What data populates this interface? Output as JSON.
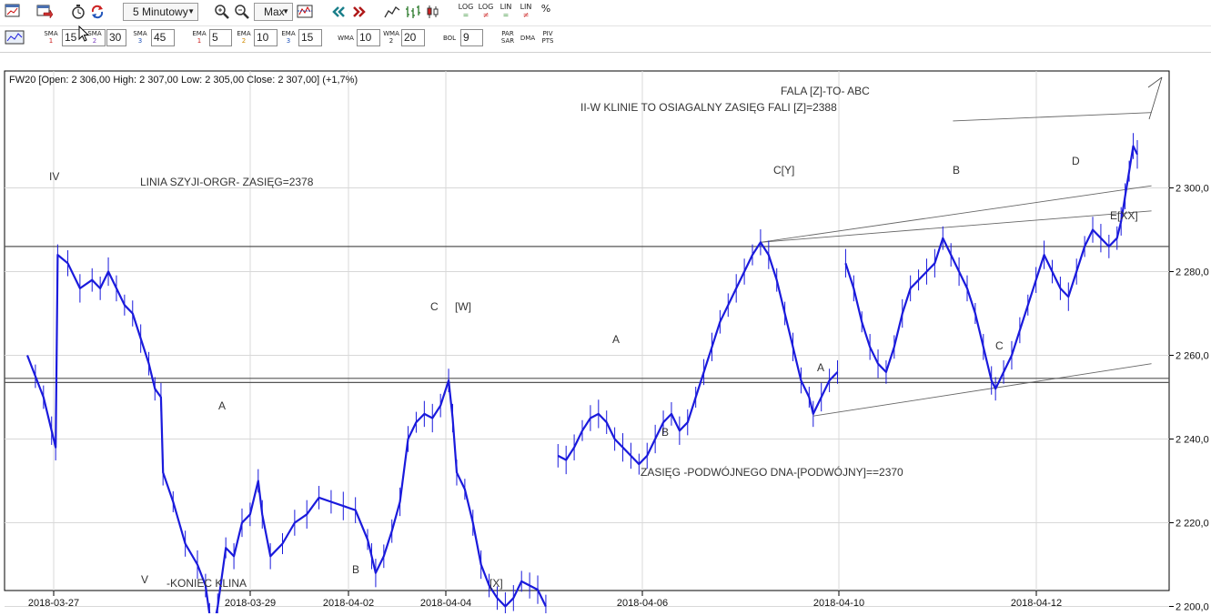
{
  "toolbar1": {
    "interval": "5 Minutowy",
    "range": "Max",
    "scale_buttons": [
      {
        "top": "LOG",
        "sub": "="
      },
      {
        "top": "LOG",
        "sub": "≠"
      },
      {
        "top": "LIN",
        "sub": "="
      },
      {
        "top": "LIN",
        "sub": "≠"
      },
      {
        "top": "%",
        "sub": ""
      }
    ]
  },
  "toolbar2": {
    "sma": [
      {
        "label": "SMA",
        "num": "1",
        "value": "15"
      },
      {
        "label": "SMA",
        "num": "2",
        "value": "30"
      },
      {
        "label": "SMA",
        "num": "3",
        "value": "45"
      }
    ],
    "ema": [
      {
        "label": "EMA",
        "num": "1",
        "value": "5"
      },
      {
        "label": "EMA",
        "num": "2",
        "value": "10"
      },
      {
        "label": "EMA",
        "num": "3",
        "value": "15"
      }
    ],
    "wma": [
      {
        "label": "WMA",
        "num": "",
        "value": "10"
      },
      {
        "label": "WMA",
        "num": "2",
        "value": "20"
      }
    ],
    "bol": {
      "label": "BOL",
      "value": "9"
    },
    "extra": [
      {
        "top": "PAR",
        "bottom": "SAR"
      },
      {
        "top": "DMA",
        "bottom": ""
      },
      {
        "top": "PIV",
        "bottom": "PTS"
      }
    ]
  },
  "chart_data": {
    "type": "line",
    "instrument": "FW20",
    "info_line": "FW20 [Open: 2 306,00  High: 2 307,00  Low: 2 305,00  Close: 2 307,00] (+1,7%)",
    "x_ticks": [
      "2018-03-27",
      "2018-03-29",
      "2018-04-02",
      "2018-04-04",
      "2018-04-06",
      "2018-04-10",
      "2018-04-12"
    ],
    "y_ticks": [
      "2 200,0",
      "2 220,0",
      "2 240,0",
      "2 260,0",
      "2 280,0",
      "2 300,0"
    ],
    "ylim": [
      2196,
      2316
    ],
    "grid": true,
    "series": [
      {
        "color": "#1a1adc",
        "points": [
          [
            0,
            2260
          ],
          [
            4,
            2255
          ],
          [
            8,
            2250
          ],
          [
            12,
            2242
          ],
          [
            14,
            2238
          ],
          [
            15,
            2284
          ],
          [
            20,
            2282
          ],
          [
            26,
            2276
          ],
          [
            32,
            2278
          ],
          [
            36,
            2276
          ],
          [
            40,
            2280
          ],
          [
            44,
            2276
          ],
          [
            48,
            2272
          ],
          [
            52,
            2270
          ],
          [
            56,
            2264
          ],
          [
            60,
            2258
          ],
          [
            63,
            2252
          ],
          [
            66,
            2250
          ],
          [
            67,
            2232
          ],
          [
            72,
            2225
          ],
          [
            78,
            2215
          ],
          [
            84,
            2210
          ],
          [
            88,
            2205
          ],
          [
            90,
            2198
          ],
          [
            92,
            2195
          ],
          [
            94,
            2200
          ],
          [
            98,
            2214
          ],
          [
            102,
            2212
          ],
          [
            106,
            2220
          ],
          [
            110,
            2222
          ],
          [
            114,
            2230
          ],
          [
            116,
            2222
          ],
          [
            120,
            2212
          ],
          [
            126,
            2215
          ],
          [
            132,
            2220
          ],
          [
            138,
            2222
          ],
          [
            144,
            2226
          ],
          [
            150,
            2225
          ],
          [
            156,
            2224
          ],
          [
            162,
            2223
          ],
          [
            168,
            2216
          ],
          [
            170,
            2212
          ],
          [
            172,
            2208
          ],
          [
            176,
            2212
          ],
          [
            180,
            2218
          ],
          [
            184,
            2225
          ],
          [
            188,
            2240
          ],
          [
            192,
            2244
          ],
          [
            196,
            2246
          ],
          [
            200,
            2245
          ],
          [
            204,
            2248
          ],
          [
            208,
            2254
          ],
          [
            210,
            2245
          ],
          [
            212,
            2232
          ],
          [
            216,
            2228
          ],
          [
            220,
            2220
          ],
          [
            224,
            2210
          ],
          [
            228,
            2205
          ],
          [
            232,
            2202
          ],
          [
            236,
            2200
          ],
          [
            240,
            2202
          ],
          [
            244,
            2206
          ],
          [
            248,
            2205
          ],
          [
            252,
            2204
          ],
          [
            256,
            2200
          ],
          [
            262,
            2236
          ],
          [
            266,
            2235
          ],
          [
            270,
            2238
          ],
          [
            274,
            2242
          ],
          [
            278,
            2245
          ],
          [
            282,
            2246
          ],
          [
            286,
            2244
          ],
          [
            290,
            2240
          ],
          [
            294,
            2238
          ],
          [
            298,
            2236
          ],
          [
            302,
            2234
          ],
          [
            306,
            2236
          ],
          [
            310,
            2240
          ],
          [
            314,
            2244
          ],
          [
            318,
            2246
          ],
          [
            322,
            2242
          ],
          [
            326,
            2244
          ],
          [
            330,
            2250
          ],
          [
            334,
            2256
          ],
          [
            338,
            2262
          ],
          [
            342,
            2268
          ],
          [
            346,
            2272
          ],
          [
            350,
            2276
          ],
          [
            354,
            2280
          ],
          [
            358,
            2284
          ],
          [
            362,
            2287
          ],
          [
            366,
            2284
          ],
          [
            370,
            2278
          ],
          [
            374,
            2270
          ],
          [
            378,
            2262
          ],
          [
            382,
            2254
          ],
          [
            386,
            2250
          ],
          [
            388,
            2246
          ],
          [
            392,
            2250
          ],
          [
            396,
            2254
          ],
          [
            400,
            2256
          ],
          [
            404,
            2282
          ],
          [
            408,
            2276
          ],
          [
            412,
            2268
          ],
          [
            416,
            2262
          ],
          [
            420,
            2258
          ],
          [
            424,
            2256
          ],
          [
            428,
            2262
          ],
          [
            432,
            2270
          ],
          [
            436,
            2276
          ],
          [
            440,
            2278
          ],
          [
            444,
            2280
          ],
          [
            448,
            2282
          ],
          [
            452,
            2288
          ],
          [
            456,
            2284
          ],
          [
            460,
            2280
          ],
          [
            464,
            2276
          ],
          [
            468,
            2270
          ],
          [
            472,
            2262
          ],
          [
            476,
            2254
          ],
          [
            478,
            2252
          ],
          [
            482,
            2256
          ],
          [
            486,
            2260
          ],
          [
            490,
            2266
          ],
          [
            494,
            2272
          ],
          [
            498,
            2278
          ],
          [
            502,
            2284
          ],
          [
            506,
            2280
          ],
          [
            510,
            2276
          ],
          [
            514,
            2274
          ],
          [
            518,
            2280
          ],
          [
            522,
            2286
          ],
          [
            526,
            2290
          ],
          [
            530,
            2288
          ],
          [
            534,
            2286
          ],
          [
            538,
            2288
          ],
          [
            540,
            2292
          ],
          [
            542,
            2298
          ],
          [
            544,
            2304
          ],
          [
            546,
            2310
          ],
          [
            548,
            2308
          ]
        ]
      }
    ],
    "annotations": [
      {
        "text": "IV"
      },
      {
        "text": "LINIA SZYJI-ORGR- ZASIĘG=2378"
      },
      {
        "text": "V"
      },
      {
        "text": "-KONIEC KLINA"
      },
      {
        "text": "A"
      },
      {
        "text": "B"
      },
      {
        "text": "C"
      },
      {
        "text": "[W]"
      },
      {
        "text": "[X]"
      },
      {
        "text": "A"
      },
      {
        "text": "B"
      },
      {
        "text": "C[Y]"
      },
      {
        "text": "A"
      },
      {
        "text": "B"
      },
      {
        "text": "C"
      },
      {
        "text": "D"
      },
      {
        "text": "E[XX]"
      },
      {
        "text": "FALA   [Z]-TO-  ABC"
      },
      {
        "text": "II-W KLINIE TO OSIAGALNY ZASIĘG FALI [Z]=2388"
      },
      {
        "text": "ZASIĘG -PODWÓJNEGO DNA-[PODWÓJNY]==2370"
      }
    ],
    "horizontal_lines": [
      2286,
      2254.5,
      2253.5,
      2195
    ],
    "trend_lines": [
      {
        "from": [
          362,
          2287
        ],
        "to": [
          555,
          2300.5
        ]
      },
      {
        "from": [
          362,
          2287
        ],
        "to": [
          555,
          2294.5
        ]
      },
      {
        "from": [
          388,
          2245.5
        ],
        "to": [
          555,
          2258
        ]
      },
      {
        "from": [
          457,
          2316
        ],
        "to": [
          555,
          2318
        ]
      }
    ]
  }
}
